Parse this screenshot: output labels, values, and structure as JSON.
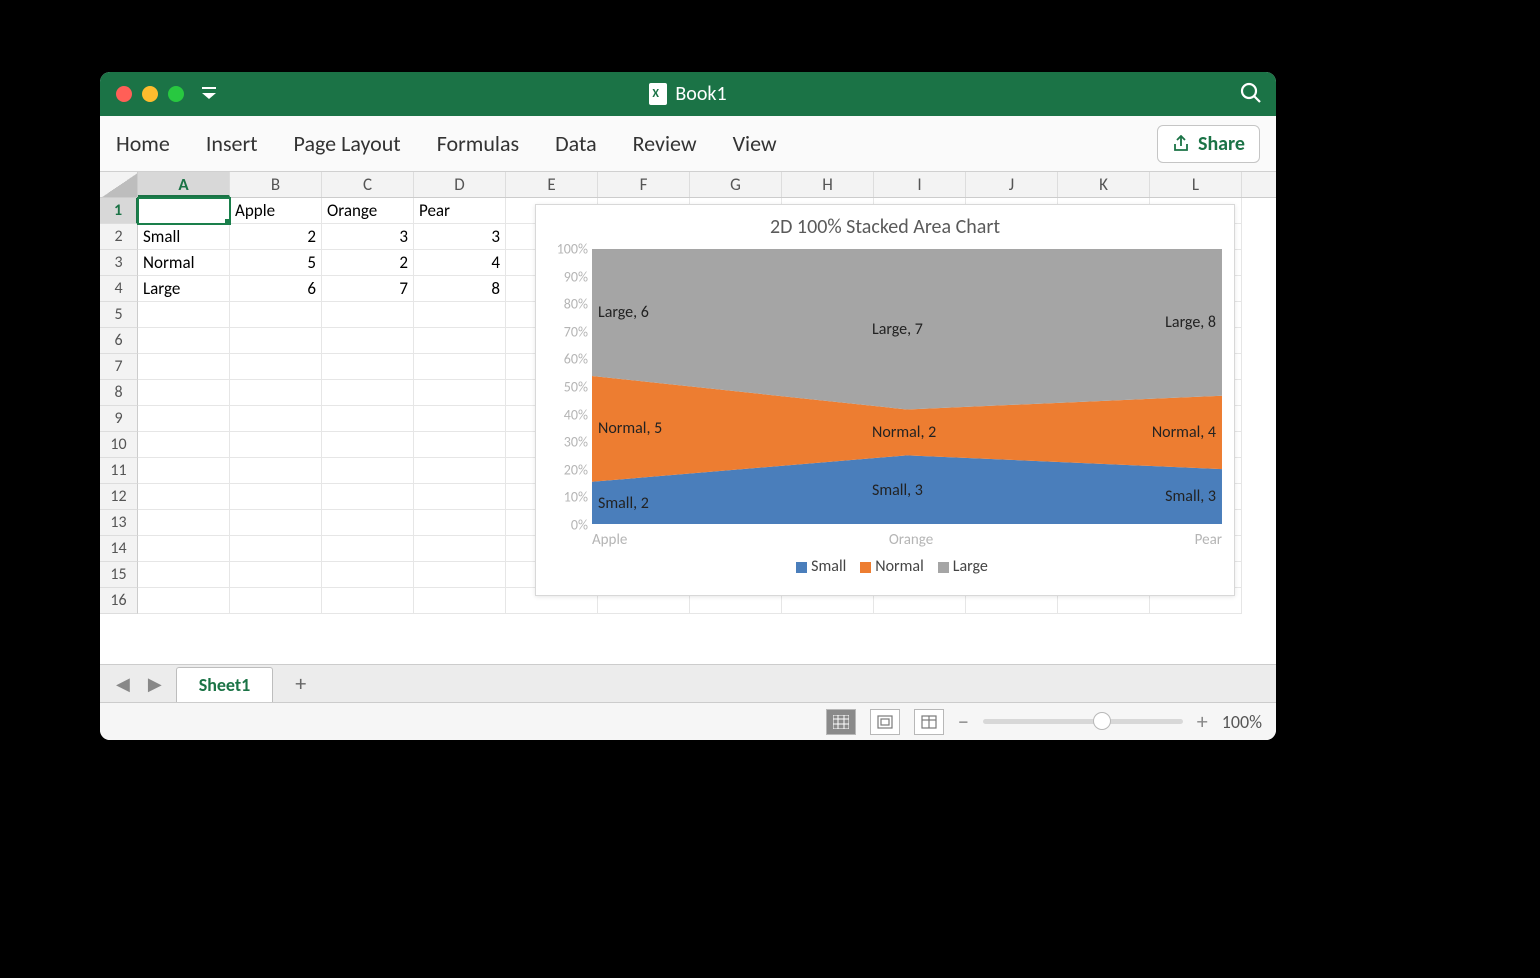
{
  "window": {
    "title": "Book1"
  },
  "ribbon": {
    "tabs": [
      "Home",
      "Insert",
      "Page Layout",
      "Formulas",
      "Data",
      "Review",
      "View"
    ],
    "share": "Share"
  },
  "columns": [
    "A",
    "B",
    "C",
    "D",
    "E",
    "F",
    "G",
    "H",
    "I",
    "J",
    "K",
    "L"
  ],
  "rowcount": 16,
  "active_cell": "A1",
  "cells": {
    "B1": "Apple",
    "C1": "Orange",
    "D1": "Pear",
    "A2": "Small",
    "B2": "2",
    "C2": "3",
    "D2": "3",
    "A3": "Normal",
    "B3": "5",
    "C3": "2",
    "D3": "4",
    "A4": "Large",
    "B4": "6",
    "C4": "7",
    "D4": "8"
  },
  "sheet": {
    "name": "Sheet1"
  },
  "status": {
    "zoom": "100%"
  },
  "chart_data": {
    "type": "area",
    "stacked": "100%",
    "title": "2D 100% Stacked Area Chart",
    "categories": [
      "Apple",
      "Orange",
      "Pear"
    ],
    "series": [
      {
        "name": "Small",
        "values": [
          2,
          3,
          3
        ],
        "color": "#4a7ebb"
      },
      {
        "name": "Normal",
        "values": [
          5,
          2,
          4
        ],
        "color": "#ed7d31"
      },
      {
        "name": "Large",
        "values": [
          6,
          7,
          8
        ],
        "color": "#a5a5a5"
      }
    ],
    "ylim": [
      0,
      100
    ],
    "ytick_step": 10,
    "ytick_format": "percent",
    "labels": [
      {
        "series": "Large",
        "cat": "Apple",
        "text": "Large, 6"
      },
      {
        "series": "Large",
        "cat": "Orange",
        "text": "Large, 7"
      },
      {
        "series": "Large",
        "cat": "Pear",
        "text": "Large, 8"
      },
      {
        "series": "Normal",
        "cat": "Apple",
        "text": "Normal, 5"
      },
      {
        "series": "Normal",
        "cat": "Orange",
        "text": "Normal, 2"
      },
      {
        "series": "Normal",
        "cat": "Pear",
        "text": "Normal, 4"
      },
      {
        "series": "Small",
        "cat": "Apple",
        "text": "Small, 2"
      },
      {
        "series": "Small",
        "cat": "Orange",
        "text": "Small, 3"
      },
      {
        "series": "Small",
        "cat": "Pear",
        "text": "Small, 3"
      }
    ]
  }
}
